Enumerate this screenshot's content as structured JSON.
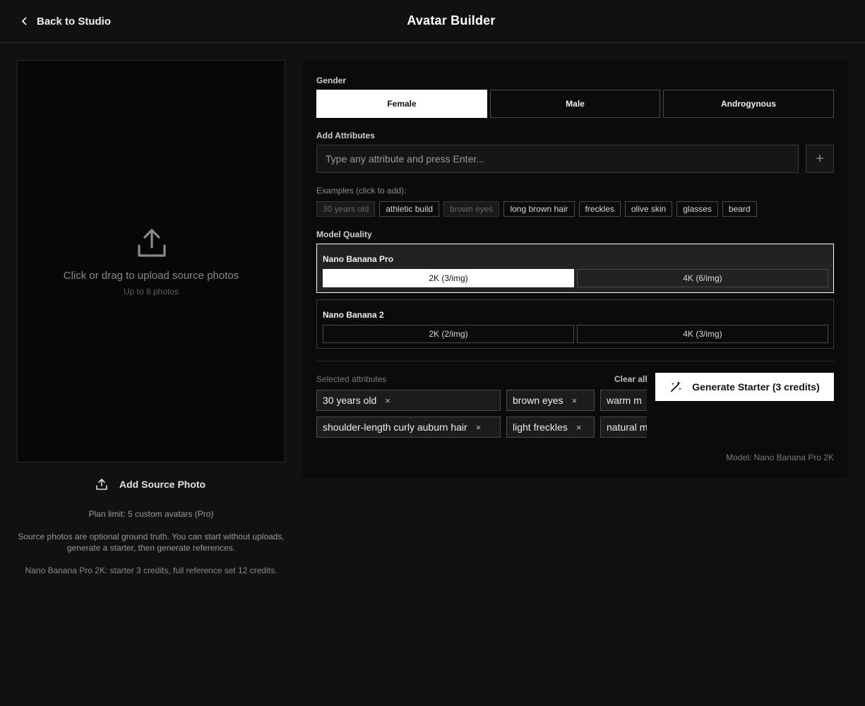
{
  "header": {
    "back_label": "Back to Studio",
    "title": "Avatar Builder"
  },
  "upload": {
    "title": "Click or drag to upload source photos",
    "subtitle": "Up to 8 photos",
    "add_button": "Add Source Photo",
    "plan_limit": "Plan limit: 5 custom avatars (Pro)",
    "info": "Source photos are optional ground truth. You can start without uploads, generate a starter, then generate references.",
    "cost_note": "Nano Banana Pro 2K: starter 3 credits, full reference set 12 credits."
  },
  "gender": {
    "label": "Gender",
    "options": [
      "Female",
      "Male",
      "Androgynous"
    ],
    "selected": "Female"
  },
  "attributes": {
    "label": "Add Attributes",
    "placeholder": "Type any attribute and press Enter...",
    "add_icon": "plus-icon",
    "examples_label": "Examples (click to add):",
    "examples": [
      "30 years old",
      "athletic build",
      "brown eyes",
      "long brown hair",
      "freckles",
      "olive skin",
      "glasses",
      "beard"
    ],
    "examples_used": [
      "30 years old",
      "brown eyes"
    ]
  },
  "quality": {
    "label": "Model Quality",
    "models": [
      {
        "name": "Nano Banana Pro",
        "options": [
          "2K (3/img)",
          "4K (6/img)"
        ],
        "selected": "2K (3/img)"
      },
      {
        "name": "Nano Banana 2",
        "options": [
          "2K (2/img)",
          "4K (3/img)"
        ],
        "selected": null
      }
    ]
  },
  "selected": {
    "label": "Selected attributes",
    "clear_label": "Clear all",
    "tags": [
      "30 years old",
      "brown eyes",
      "warm m",
      "shoulder-length curly auburn hair",
      "light freckles",
      "natural m"
    ],
    "remove_glyph": "×"
  },
  "generate": {
    "label": "Generate Starter (3 credits)",
    "icon": "magic-wand-icon"
  },
  "model_note": "Model: Nano Banana Pro 2K",
  "colors": {
    "background": "#111111",
    "panel": "#0b0b0b",
    "accent": "#ffffff",
    "selected_card": "#222222"
  }
}
